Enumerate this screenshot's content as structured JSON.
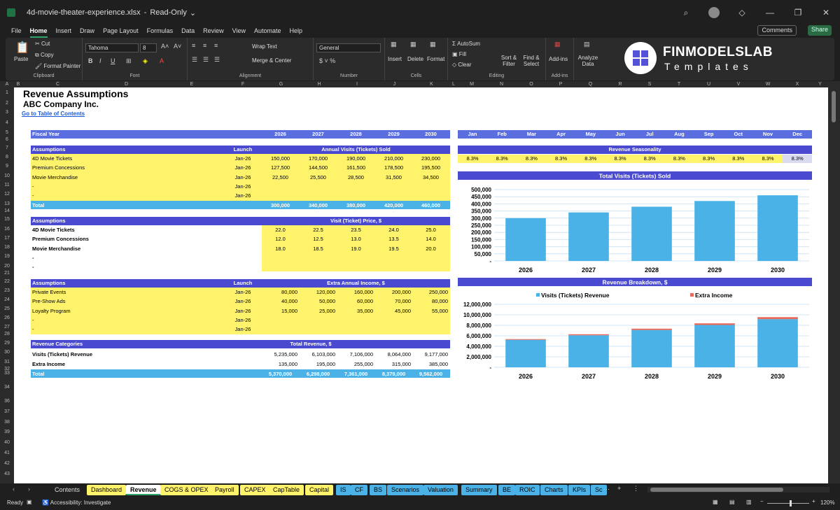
{
  "window": {
    "filename": "4d-movie-theater-experience.xlsx",
    "sep": "-",
    "mode": "Read-Only"
  },
  "menu": {
    "items": [
      "File",
      "Home",
      "Insert",
      "Draw",
      "Page Layout",
      "Formulas",
      "Data",
      "Review",
      "View",
      "Automate",
      "Help"
    ],
    "active": "Home",
    "comments": "Comments",
    "share": "Share"
  },
  "ribbon": {
    "paste": "Paste",
    "cut": "Cut",
    "copy": "Copy",
    "format_painter": "Format Painter",
    "clipboard": "Clipboard",
    "font_name": "Tahoma",
    "font_size": "8",
    "font": "Font",
    "wrap_text": "Wrap Text",
    "merge_center": "Merge & Center",
    "alignment": "Alignment",
    "number_format": "General",
    "number": "Number",
    "insert": "Insert",
    "delete": "Delete",
    "format": "Format",
    "cells": "Cells",
    "autosum": "AutoSum",
    "fill": "Fill",
    "clear": "Clear",
    "sort_filter": "Sort & Filter",
    "find_select": "Find & Select",
    "editing": "Editing",
    "addins": "Add-ins",
    "addins_group": "Add-ins",
    "analyze_data": "Analyze Data",
    "brand_name": "FINMODELSLAB",
    "brand_sub": "Templates"
  },
  "columns": [
    "A",
    "B",
    "C",
    "D",
    "E",
    "F",
    "G",
    "H",
    "I",
    "J",
    "K",
    "L",
    "M",
    "N",
    "O",
    "P",
    "Q",
    "R",
    "S",
    "T",
    "U",
    "V",
    "W",
    "X",
    "Y"
  ],
  "rows": [
    "1",
    "2",
    "3",
    "4",
    "5",
    "6",
    "7",
    "8",
    "9",
    "10",
    "11",
    "12",
    "13",
    "14",
    "15",
    "16",
    "17",
    "18",
    "19",
    "20",
    "21",
    "22",
    "23",
    "24",
    "25",
    "26",
    "27",
    "28",
    "29",
    "30",
    "31",
    "32",
    "33",
    "34",
    "36",
    "37",
    "38",
    "39",
    "40",
    "41",
    "42",
    "43"
  ],
  "sheet": {
    "title": "Revenue Assumptions",
    "company": "ABC Company Inc.",
    "toc_link": "Go to Table of Contents",
    "fiscal_label": "Fiscal Year",
    "years": [
      "2026",
      "2027",
      "2028",
      "2029",
      "2030"
    ],
    "months": [
      "Jan",
      "Feb",
      "Mar",
      "Apr",
      "May",
      "Jun",
      "Jul",
      "Aug",
      "Sep",
      "Oct",
      "Nov",
      "Dec"
    ],
    "visits": {
      "label": "Assumptions",
      "launch_label": "Launch",
      "title": "Annual Visits (Tickets) Sold",
      "rows": [
        {
          "name": "4D Movie Tickets",
          "launch": "Jan-26",
          "values": [
            "150,000",
            "170,000",
            "190,000",
            "210,000",
            "230,000"
          ]
        },
        {
          "name": "Premium Concessions",
          "launch": "Jan-26",
          "values": [
            "127,500",
            "144,500",
            "161,500",
            "178,500",
            "195,500"
          ]
        },
        {
          "name": "Movie Merchandise",
          "launch": "Jan-26",
          "values": [
            "22,500",
            "25,500",
            "28,500",
            "31,500",
            "34,500"
          ]
        },
        {
          "name": "-",
          "launch": "Jan-26",
          "values": [
            "",
            "",
            "",
            "",
            ""
          ]
        },
        {
          "name": "-",
          "launch": "Jan-26",
          "values": [
            "",
            "",
            "",
            "",
            ""
          ]
        }
      ],
      "total_label": "Total",
      "totals": [
        "300,000",
        "340,000",
        "380,000",
        "420,000",
        "460,000"
      ]
    },
    "price": {
      "label": "Assumptions",
      "title": "Visit (Ticket) Price, $",
      "rows": [
        {
          "name": "4D Movie Tickets",
          "values": [
            "22.0",
            "22.5",
            "23.5",
            "24.0",
            "25.0"
          ]
        },
        {
          "name": "Premium Concessions",
          "values": [
            "12.0",
            "12.5",
            "13.0",
            "13.5",
            "14.0"
          ]
        },
        {
          "name": "Movie Merchandise",
          "values": [
            "18.0",
            "18.5",
            "19.0",
            "19.5",
            "20.0"
          ]
        },
        {
          "name": "-",
          "values": [
            "",
            "",
            "",
            "",
            ""
          ]
        },
        {
          "name": "-",
          "values": [
            "",
            "",
            "",
            "",
            ""
          ]
        }
      ]
    },
    "extra": {
      "label": "Assumptions",
      "launch_label": "Launch",
      "title": "Extra Annual Income, $",
      "rows": [
        {
          "name": "Private Events",
          "launch": "Jan-26",
          "values": [
            "80,000",
            "120,000",
            "160,000",
            "200,000",
            "250,000"
          ]
        },
        {
          "name": "Pre-Show Ads",
          "launch": "Jan-26",
          "values": [
            "40,000",
            "50,000",
            "60,000",
            "70,000",
            "80,000"
          ]
        },
        {
          "name": "Loyalty Program",
          "launch": "Jan-26",
          "values": [
            "15,000",
            "25,000",
            "35,000",
            "45,000",
            "55,000"
          ]
        },
        {
          "name": "-",
          "launch": "Jan-26",
          "values": [
            "",
            "",
            "",
            "",
            ""
          ]
        },
        {
          "name": "-",
          "launch": "Jan-26",
          "values": [
            "",
            "",
            "",
            "",
            ""
          ]
        }
      ]
    },
    "revenue": {
      "label": "Revenue Categories",
      "title": "Total Revenue, $",
      "rows": [
        {
          "name": "Visits (Tickets) Revenue",
          "values": [
            "5,235,000",
            "6,103,000",
            "7,106,000",
            "8,064,000",
            "9,177,000"
          ]
        },
        {
          "name": "Extra Income",
          "values": [
            "135,000",
            "195,000",
            "255,000",
            "315,000",
            "385,000"
          ]
        }
      ],
      "total_label": "Total",
      "totals": [
        "5,370,000",
        "6,298,000",
        "7,361,000",
        "8,379,000",
        "9,562,000"
      ]
    },
    "seasonality": {
      "title": "Revenue Seasonality",
      "values": [
        "8.3%",
        "8.3%",
        "8.3%",
        "8.3%",
        "8.3%",
        "8.3%",
        "8.3%",
        "8.3%",
        "8.3%",
        "8.3%",
        "8.3%",
        "8.3%"
      ]
    }
  },
  "chart_data": [
    {
      "type": "bar",
      "title": "Total Visits (Tickets) Sold",
      "categories": [
        "2026",
        "2027",
        "2028",
        "2029",
        "2030"
      ],
      "values": [
        300000,
        340000,
        380000,
        420000,
        460000
      ],
      "ylim": [
        0,
        500000
      ],
      "yticks": [
        "500,000",
        "450,000",
        "400,000",
        "350,000",
        "300,000",
        "250,000",
        "200,000",
        "150,000",
        "100,000",
        "50,000",
        "-"
      ],
      "color": "#4ab2e6",
      "grid": true
    },
    {
      "type": "bar",
      "title": "Revenue Breakdown, $",
      "categories": [
        "2026",
        "2027",
        "2028",
        "2029",
        "2030"
      ],
      "series": [
        {
          "name": "Visits (Tickets) Revenue",
          "values": [
            5235000,
            6103000,
            7106000,
            8064000,
            9177000
          ],
          "color": "#4ab2e6"
        },
        {
          "name": "Extra Income",
          "values": [
            135000,
            195000,
            255000,
            315000,
            385000
          ],
          "color": "#e86a5a"
        }
      ],
      "stacked": true,
      "ylim": [
        0,
        12000000
      ],
      "yticks": [
        "12,000,000",
        "10,000,000",
        "8,000,000",
        "6,000,000",
        "4,000,000",
        "2,000,000",
        "-"
      ],
      "legend": "top",
      "grid": true
    }
  ],
  "tabs": [
    {
      "label": "Contents",
      "color": "#1f1f1f",
      "text": "#ddd"
    },
    {
      "label": "Dashboard",
      "color": "#fff36b",
      "text": "#000"
    },
    {
      "label": "Revenue",
      "color": "#ffffff",
      "text": "#000",
      "active": true
    },
    {
      "label": "COGS & OPEX",
      "color": "#fff36b",
      "text": "#000"
    },
    {
      "label": "Payroll",
      "color": "#fff36b",
      "text": "#000"
    },
    {
      "label": "CAPEX",
      "color": "#fff36b",
      "text": "#000"
    },
    {
      "label": "CapTable",
      "color": "#fff36b",
      "text": "#000"
    },
    {
      "label": "Capital",
      "color": "#fff36b",
      "text": "#000"
    },
    {
      "label": "IS",
      "color": "#4ab2e6",
      "text": "#000"
    },
    {
      "label": "CF",
      "color": "#4ab2e6",
      "text": "#000"
    },
    {
      "label": "BS",
      "color": "#4ab2e6",
      "text": "#000"
    },
    {
      "label": "Scenarios",
      "color": "#4ab2e6",
      "text": "#000"
    },
    {
      "label": "Valuation",
      "color": "#4ab2e6",
      "text": "#000"
    },
    {
      "label": "Summary",
      "color": "#4ab2e6",
      "text": "#000"
    },
    {
      "label": "BE",
      "color": "#4ab2e6",
      "text": "#000"
    },
    {
      "label": "ROIC",
      "color": "#4ab2e6",
      "text": "#000"
    },
    {
      "label": "Charts",
      "color": "#4ab2e6",
      "text": "#000"
    },
    {
      "label": "KPIs",
      "color": "#4ab2e6",
      "text": "#000"
    },
    {
      "label": "Sc",
      "color": "#4ab2e6",
      "text": "#000"
    }
  ],
  "status": {
    "ready": "Ready",
    "accessibility": "Accessibility: Investigate",
    "zoom": "120%"
  }
}
